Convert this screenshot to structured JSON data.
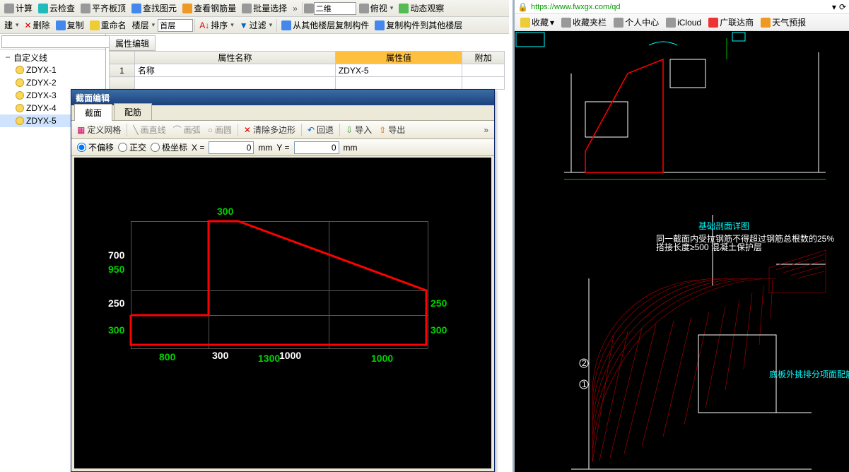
{
  "toolbar1": {
    "calc": "计算",
    "cloud": "云检查",
    "flatten": "平齐板顶",
    "find": "查找图元",
    "rebar": "查看钢筋量",
    "batch": "批量选择",
    "two_d": "二维",
    "iso": "俯视",
    "dyn": "动态观察"
  },
  "toolbar2": {
    "build": "建",
    "del": "删除",
    "copy": "复制",
    "rename": "重命名",
    "layer": "楼层",
    "first_floor": "首层",
    "sort": "排序",
    "filter": "过滤",
    "copy_from": "从其他楼层复制构件",
    "copy_to": "复制构件到其他楼层"
  },
  "tree": {
    "root": "自定义线",
    "items": [
      "ZDYX-1",
      "ZDYX-2",
      "ZDYX-3",
      "ZDYX-4",
      "ZDYX-5"
    ]
  },
  "attr": {
    "title": "属性编辑",
    "col_name": "属性名称",
    "col_val": "属性值",
    "col_extra": "附加",
    "rows": [
      {
        "n": "1",
        "name": "名称",
        "val": "ZDYX-5"
      },
      {
        "n": "",
        "name": "",
        "val": ""
      }
    ]
  },
  "dialog": {
    "title": "截面编辑",
    "tabs": [
      "截面",
      "配筋"
    ],
    "tb": {
      "grid": "定义网格",
      "line": "画直线",
      "arc": "画弧",
      "circle": "画圆",
      "clear": "清除多边形",
      "undo": "回退",
      "import": "导入",
      "export": "导出"
    },
    "coord": {
      "no_offset": "不偏移",
      "ortho": "正交",
      "polar": "极坐标",
      "x": "X =",
      "xval": "0",
      "mm": "mm",
      "y": "Y =",
      "yval": "0"
    },
    "dims": {
      "top": "300",
      "left_700": "700",
      "left_950": "950",
      "left_250": "250",
      "left_300": "300",
      "bot_800": "800",
      "bot_300": "300",
      "bot_1300": "1300",
      "bot_1000a": "1000",
      "bot_1000b": "1000",
      "right_250": "250",
      "right_300": "300"
    }
  },
  "browser": {
    "url": "https://www.fwxgx.com/qd",
    "bookmarks": {
      "fav": "收藏",
      "folder": "收藏夹栏",
      "personal": "个人中心",
      "icloud": "iCloud",
      "glodon": "广联达商",
      "weather": "天气预报"
    },
    "cad_title": "基础剖面详图",
    "cad_title2": "底板外挑排分项面配筋图"
  }
}
